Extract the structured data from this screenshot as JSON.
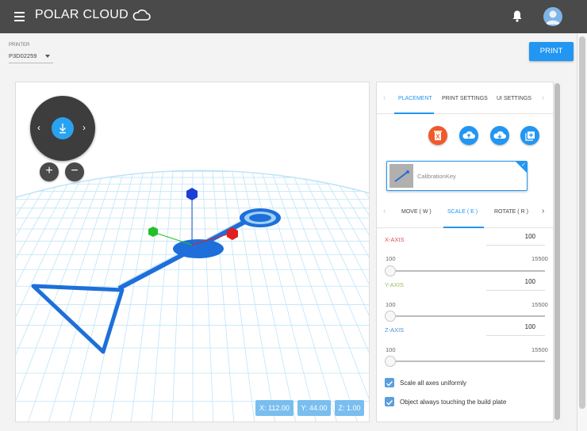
{
  "app": {
    "logo_text": "POLAR CLOUD"
  },
  "header_icons": {
    "menu": "hamburger-menu-icon",
    "notifications": "bell-icon",
    "profile": "user-avatar-icon"
  },
  "printer": {
    "label": "PRINTER",
    "selected": "P3D02259"
  },
  "print_button": "PRINT",
  "viewport": {
    "nav": {
      "left": "‹",
      "right": "›",
      "center_icon": "drop-to-plate-icon"
    },
    "zoom_in": "+",
    "zoom_out": "−",
    "coords": {
      "x": "X: 112.00",
      "y": "Y: 44.00",
      "z": "Z: 1.00"
    },
    "gizmo_colors": {
      "x": "#e02020",
      "y": "#22c02a",
      "z": "#1a3fd6"
    },
    "model_color": "#1e6fd9"
  },
  "panel": {
    "tabs": [
      "PLACEMENT",
      "PRINT SETTINGS",
      "UI SETTINGS"
    ],
    "active_tab": 0,
    "actions": [
      {
        "name": "delete-icon",
        "color": "#f05a2b"
      },
      {
        "name": "cloud-upload-icon",
        "color": "#2196f3"
      },
      {
        "name": "cloud-download-icon",
        "color": "#2196f3"
      },
      {
        "name": "add-copy-icon",
        "color": "#2196f3"
      }
    ],
    "object": {
      "name": "CalibrationKey"
    },
    "subtabs": [
      "MOVE ( W )",
      "SCALE ( E )",
      "ROTATE ( R )"
    ],
    "active_subtab": 1,
    "axes": [
      {
        "label": "X-AXIS",
        "color": "#e05050",
        "value": "100",
        "min": "100",
        "max": "15500"
      },
      {
        "label": "Y-AXIS",
        "color": "#9bc05a",
        "value": "100",
        "min": "100",
        "max": "15500"
      },
      {
        "label": "Z-AXIS",
        "color": "#4a8fd8",
        "value": "100",
        "min": "100",
        "max": "15500"
      }
    ],
    "options": [
      {
        "label": "Scale all axes uniformly",
        "checked": true
      },
      {
        "label": "Object always touching the build plate",
        "checked": true
      }
    ]
  }
}
